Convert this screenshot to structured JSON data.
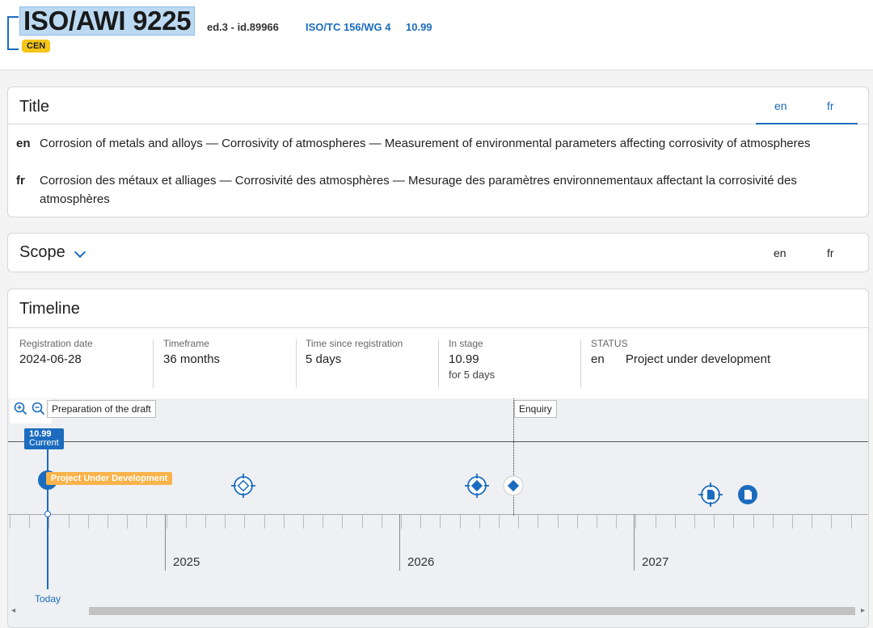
{
  "header": {
    "code": "ISO/AWI 9225",
    "edition_info": "ed.3 - id.89966",
    "committee": "ISO/TC 156/WG 4",
    "stage": "10.99",
    "badge": "CEN"
  },
  "title_section": {
    "heading": "Title",
    "tabs": [
      "en",
      "fr"
    ],
    "active_tab": "en",
    "rows": [
      {
        "lang": "en",
        "text": "Corrosion of metals and alloys — Corrosivity of atmospheres — Measurement of environmental parameters affecting corrosivity of atmospheres"
      },
      {
        "lang": "fr",
        "text": "Corrosion des métaux et alliages — Corrosivité des atmosphères — Mesurage des paramètres environnementaux affectant la corrosivité des atmosphères"
      }
    ]
  },
  "scope_section": {
    "heading": "Scope",
    "tabs": [
      "en",
      "fr"
    ]
  },
  "timeline_section": {
    "heading": "Timeline",
    "stats": [
      {
        "label": "Registration date",
        "value": "2024-06-28"
      },
      {
        "label": "Timeframe",
        "value": "36 months"
      },
      {
        "label": "Time since registration",
        "value": "5 days"
      },
      {
        "label": "In stage",
        "value": "10.99",
        "sub": "for 5 days"
      },
      {
        "label": "STATUS",
        "lang": "en",
        "value": "Project under development"
      }
    ],
    "chart": {
      "phases": [
        "Preparation of the draft",
        "Enquiry"
      ],
      "current_stage": "10.99",
      "current_label": "Current",
      "status_tag": "Project Under Development",
      "years": [
        "2025",
        "2026",
        "2027"
      ],
      "today_label": "Today"
    },
    "colors": {
      "accent": "#1b6cbf",
      "status": "#f9b34a"
    }
  },
  "icons": [
    "zoom-in-icon",
    "zoom-out-icon",
    "chevron-down-icon",
    "target-icon",
    "diamond-icon",
    "document-icon"
  ]
}
